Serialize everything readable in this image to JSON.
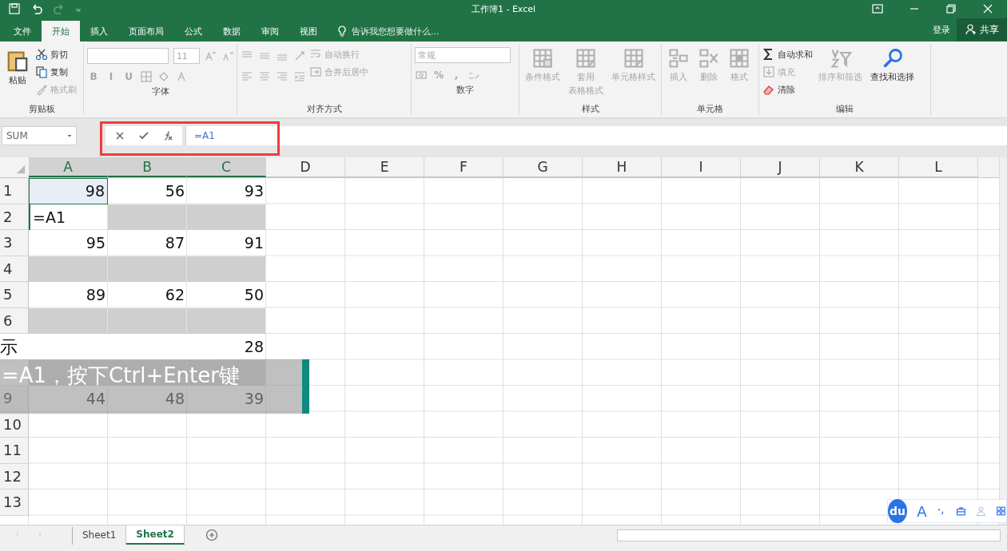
{
  "window": {
    "title": "工作簿1 - Excel"
  },
  "menu_tabs": [
    {
      "label": "文件",
      "selected": false
    },
    {
      "label": "开始",
      "selected": true
    },
    {
      "label": "插入",
      "selected": false
    },
    {
      "label": "页面布局",
      "selected": false
    },
    {
      "label": "公式",
      "selected": false
    },
    {
      "label": "数据",
      "selected": false
    },
    {
      "label": "审阅",
      "selected": false
    },
    {
      "label": "视图",
      "selected": false
    }
  ],
  "tell_me": {
    "placeholder": "告诉我您想要做什么..."
  },
  "account": {
    "sign_in": "登录",
    "share": "共享"
  },
  "ribbon": {
    "clipboard": {
      "label": "剪贴板",
      "paste": "粘贴",
      "items": [
        {
          "kind": "cut",
          "label": "剪切",
          "disabled": false
        },
        {
          "kind": "copy",
          "label": "复制",
          "disabled": false
        },
        {
          "kind": "brush",
          "label": "格式刷",
          "disabled": true
        }
      ]
    },
    "font": {
      "label": "字体",
      "size": "11",
      "styles": [
        "B",
        "I",
        "U"
      ],
      "disabled": true
    },
    "alignment": {
      "label": "对齐方式",
      "items": [
        {
          "kind": "wrap",
          "label": "自动换行"
        },
        {
          "kind": "merge",
          "label": "合并后居中"
        }
      ],
      "disabled": true
    },
    "number": {
      "label": "数字",
      "format": "常规",
      "symbols": [
        "%",
        ","
      ],
      "disabled": true
    },
    "styles": {
      "label": "样式",
      "items": [
        {
          "kind": "condformat",
          "lines": [
            "条件格式"
          ]
        },
        {
          "kind": "tableformat",
          "lines": [
            "套用",
            "表格格式"
          ]
        },
        {
          "kind": "cellstyle",
          "lines": [
            "单元格样式"
          ]
        }
      ],
      "disabled": true
    },
    "cells": {
      "label": "单元格",
      "items": [
        {
          "kind": "insert",
          "lines": [
            "插入"
          ]
        },
        {
          "kind": "delete",
          "lines": [
            "删除"
          ]
        },
        {
          "kind": "format",
          "lines": [
            "格式"
          ]
        }
      ],
      "disabled": true
    },
    "editing": {
      "label": "编辑",
      "items": [
        {
          "kind": "autosum",
          "label": "自动求和",
          "disabled": false
        },
        {
          "kind": "fill",
          "label": "填充",
          "disabled": true
        },
        {
          "kind": "clear",
          "label": "清除",
          "disabled": false
        }
      ],
      "big": [
        {
          "kind": "sort",
          "label": "排序和筛选",
          "disabled": true
        },
        {
          "kind": "find",
          "label": "查找和选择",
          "disabled": false
        }
      ]
    }
  },
  "formula_bar": {
    "name_box": "SUM",
    "formula": "=A1",
    "highlighted": true
  },
  "columns": [
    {
      "label": "A",
      "selected": true
    },
    {
      "label": "B",
      "selected": true
    },
    {
      "label": "C",
      "selected": true
    },
    {
      "label": "D",
      "selected": false
    },
    {
      "label": "E",
      "selected": false
    },
    {
      "label": "F",
      "selected": false
    },
    {
      "label": "G",
      "selected": false
    },
    {
      "label": "H",
      "selected": false
    },
    {
      "label": "I",
      "selected": false
    },
    {
      "label": "J",
      "selected": false
    },
    {
      "label": "K",
      "selected": false
    },
    {
      "label": "L",
      "selected": false
    }
  ],
  "rows": [
    {
      "header": "1",
      "cells": [
        {
          "kind": "active",
          "value": "98"
        },
        {
          "kind": "number",
          "value": "56"
        },
        {
          "kind": "number",
          "value": "93"
        }
      ]
    },
    {
      "header": "2",
      "cells": [
        {
          "kind": "editing",
          "value": "=A1"
        },
        {
          "kind": "gray"
        },
        {
          "kind": "gray"
        }
      ]
    },
    {
      "header": "3",
      "cells": [
        {
          "kind": "number",
          "value": "95"
        },
        {
          "kind": "number",
          "value": "87"
        },
        {
          "kind": "number",
          "value": "91"
        }
      ]
    },
    {
      "header": "4",
      "cells": [
        {
          "kind": "gray"
        },
        {
          "kind": "gray"
        },
        {
          "kind": "gray"
        }
      ]
    },
    {
      "header": "5",
      "cells": [
        {
          "kind": "number",
          "value": "89"
        },
        {
          "kind": "number",
          "value": "62"
        },
        {
          "kind": "number",
          "value": "50"
        }
      ]
    },
    {
      "header": "6",
      "cells": [
        {
          "kind": "gray"
        },
        {
          "kind": "gray"
        },
        {
          "kind": "gray"
        }
      ]
    },
    {
      "cells": [
        {
          "kind": "blank"
        },
        {
          "kind": "blank"
        },
        {
          "kind": "number",
          "value": "28"
        }
      ]
    },
    {
      "cells": [
        {
          "kind": "gray"
        },
        {
          "kind": "gray"
        },
        {
          "kind": "gray"
        }
      ]
    },
    {
      "header": "9",
      "cells": [
        {
          "kind": "number",
          "value": "44"
        },
        {
          "kind": "number",
          "value": "48"
        },
        {
          "kind": "number",
          "value": "39"
        }
      ]
    },
    {
      "header": "10",
      "cells": []
    },
    {
      "header": "11",
      "cells": []
    },
    {
      "header": "12",
      "cells": []
    },
    {
      "header": "13",
      "cells": []
    }
  ],
  "subtitle": {
    "lines": [
      "示",
      "=A1，按下Ctrl+Enter键"
    ]
  },
  "ime_toolbar": {
    "logo": "du",
    "letter": "A"
  },
  "sheets": [
    {
      "label": "Sheet1",
      "selected": false
    },
    {
      "label": "Sheet2",
      "selected": true
    }
  ]
}
